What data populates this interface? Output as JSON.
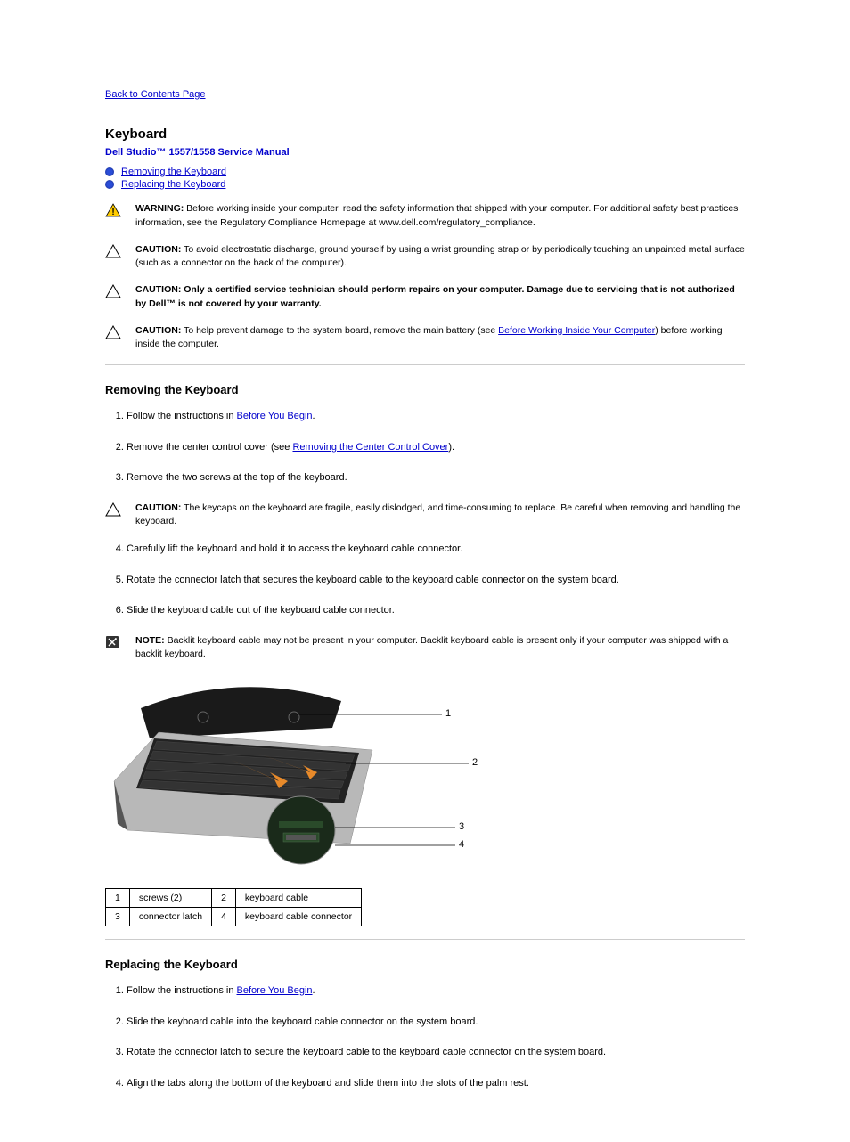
{
  "back_link": "Back to Contents Page",
  "page_title": "Keyboard",
  "manual_title": "Dell Studio™ 1557/1558 Service Manual",
  "toc": {
    "removing": "Removing the Keyboard",
    "replacing": "Replacing the Keyboard"
  },
  "notices": {
    "warning": {
      "label": "WARNING:",
      "text": "Before working inside your computer, read the safety information that shipped with your computer. For additional safety best practices information, see the Regulatory Compliance Homepage at www.dell.com/regulatory_compliance."
    },
    "caution_esd": {
      "label": "CAUTION:",
      "text": "To avoid electrostatic discharge, ground yourself by using a wrist grounding strap or by periodically touching an unpainted metal surface (such as a connector on the back of the computer)."
    },
    "caution_tech": {
      "label": "CAUTION:",
      "text": "Only a certified service technician should perform repairs on your computer. Damage due to servicing that is not authorized by Dell™ is not covered by your warranty."
    },
    "caution_board": {
      "label": "CAUTION:",
      "text_prefix": "To help prevent damage to the system board, remove the main battery (see ",
      "link_text": "Before Working Inside Your Computer",
      "text_suffix": ") before working inside the computer."
    },
    "caution_keycaps": {
      "label": "CAUTION:",
      "text": "The keycaps on the keyboard are fragile, easily dislodged, and time-consuming to replace. Be careful when removing and handling the keyboard."
    },
    "note_palmrest": {
      "label": "NOTE:",
      "text": "Backlit keyboard cable may not be present in your computer. Backlit keyboard cable is present only if your computer was shipped with a backlit keyboard."
    }
  },
  "sections": {
    "removing": {
      "title": "Removing the Keyboard",
      "steps": [
        {
          "text_prefix": "Follow the instructions in ",
          "link": "Before You Begin",
          "text_suffix": "."
        },
        {
          "text_prefix": "Remove the center control cover (see ",
          "link": "Removing the Center Control Cover",
          "text_suffix": ")."
        },
        {
          "text": "Remove the two screws at the top of the keyboard."
        },
        {
          "text": "Carefully lift the keyboard and hold it to access the keyboard cable connector."
        },
        {
          "text": "Rotate the connector latch that secures the keyboard cable to the keyboard cable connector on the system board."
        },
        {
          "text": "Slide the keyboard cable out of the keyboard cable connector."
        }
      ]
    },
    "replacing": {
      "title": "Replacing the Keyboard",
      "steps": [
        {
          "text_prefix": "Follow the instructions in ",
          "link": "Before You Begin",
          "text_suffix": "."
        },
        {
          "text": "Slide the keyboard cable into the keyboard cable connector on the system board."
        },
        {
          "text": "Rotate the connector latch to secure the keyboard cable to the keyboard cable connector on the system board."
        },
        {
          "text": "Align the tabs along the bottom of the keyboard and slide them into the slots of the palm rest."
        }
      ]
    }
  },
  "figure": {
    "callouts": {
      "1": "1",
      "2": "2",
      "3": "3",
      "4": "4"
    },
    "legend": [
      {
        "num": "1",
        "label": "screws (2)"
      },
      {
        "num": "2",
        "label": "keyboard cable"
      },
      {
        "num": "3",
        "label": "connector latch"
      },
      {
        "num": "4",
        "label": "keyboard cable connector"
      }
    ]
  }
}
